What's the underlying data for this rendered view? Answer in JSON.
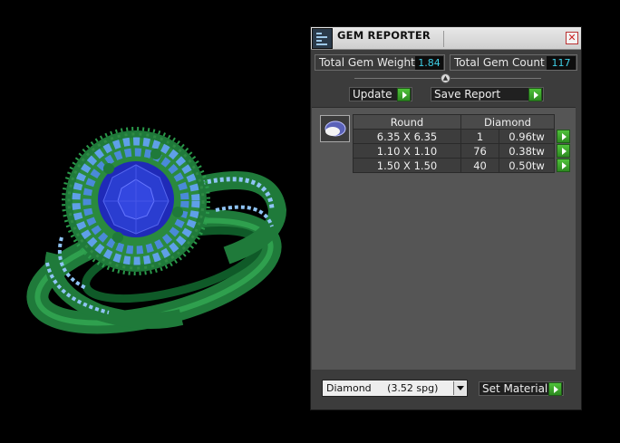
{
  "panel": {
    "title": "GEM REPORTER",
    "close_glyph": "✕",
    "total_gem_weight_label": "Total Gem Weight",
    "total_gem_weight_value": "1.84",
    "total_gem_count_label": "Total Gem Count",
    "total_gem_count_value": "117",
    "update_label": "Update",
    "save_report_label": "Save Report",
    "table": {
      "headers": [
        "Round",
        "Diamond"
      ],
      "rows": [
        {
          "size": "6.35 X 6.35",
          "count": "1",
          "weight": "0.96tw"
        },
        {
          "size": "1.10 X 1.10",
          "count": "76",
          "weight": "0.38tw"
        },
        {
          "size": "1.50 X 1.50",
          "count": "40",
          "weight": "0.50tw"
        }
      ]
    },
    "material_select_value": "Diamond     (3.52 spg)",
    "set_material_label": "Set Material"
  },
  "colors": {
    "ring_metal": "#1f7a3a",
    "center_stone": "#2a3dd0",
    "accent_stones": "#5fa0e8",
    "value_text": "#3fd0e8",
    "action_green": "#3aa52a"
  },
  "icons": {
    "title_icon": "gem-reporter-icon",
    "close": "close-icon",
    "arrow": "play-arrow-icon",
    "thumb": "round-gem-icon",
    "dropdown": "chevron-down-icon"
  }
}
